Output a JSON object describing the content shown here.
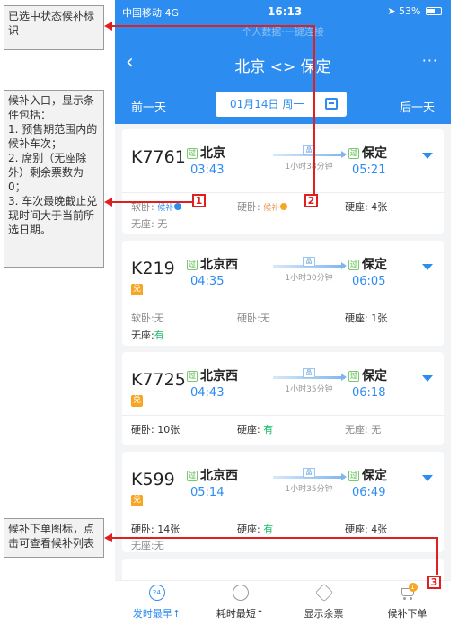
{
  "statusbar": {
    "carrier": "中国移动 4G",
    "time": "16:13",
    "battery": "53%"
  },
  "faded_subtitle": "个人数据·一键连接",
  "nav": {
    "title": "北京 <> 保定",
    "back": "‹",
    "more": "···"
  },
  "datebar": {
    "prev": "前一天",
    "date": "01月14日 周一",
    "next": "后一天"
  },
  "trains": [
    {
      "no": "K7761",
      "dui": false,
      "from": "北京",
      "depart": "03:43",
      "duration": "1小时38分钟",
      "to": "保定",
      "arrive": "05:21",
      "seats": [
        {
          "label": "软卧:",
          "value": "候补",
          "style": "blue",
          "dot": "#2d8cf0"
        },
        {
          "label": "硬卧:",
          "value": "候补",
          "style": "orange",
          "dot": "#f6a623"
        },
        {
          "label": "硬座:",
          "value": "4张",
          "style": "dark"
        },
        {
          "label": "无座:",
          "value": "无",
          "style": "plain"
        }
      ]
    },
    {
      "no": "K219",
      "dui": true,
      "from": "北京西",
      "depart": "04:35",
      "duration": "1小时30分钟",
      "to": "保定",
      "arrive": "06:05",
      "seats": [
        {
          "label": "软卧:",
          "value": "无",
          "style": "plain"
        },
        {
          "label": "硬卧:",
          "value": "无",
          "style": "plain"
        },
        {
          "label": "硬座:",
          "value": "1张",
          "style": "dark"
        },
        {
          "label": "无座:",
          "value": "有",
          "style": "green"
        }
      ]
    },
    {
      "no": "K7725",
      "dui": true,
      "from": "北京西",
      "depart": "04:43",
      "duration": "1小时35分钟",
      "to": "保定",
      "arrive": "06:18",
      "seats": [
        {
          "label": "硬卧:",
          "value": "10张",
          "style": "dark"
        },
        {
          "label": "硬座:",
          "value": "有",
          "style": "green"
        },
        {
          "label": "无座:",
          "value": "无",
          "style": "plain"
        }
      ]
    },
    {
      "no": "K599",
      "dui": true,
      "from": "北京西",
      "depart": "05:14",
      "duration": "1小时35分钟",
      "to": "保定",
      "arrive": "06:49",
      "seats": [
        {
          "label": "硬卧:",
          "value": "14张",
          "style": "dark"
        },
        {
          "label": "硬座:",
          "value": "有",
          "style": "green"
        },
        {
          "label": "硬座:",
          "value": "4张",
          "style": "dark"
        },
        {
          "label": "无座:",
          "value": "无",
          "style": "plain"
        }
      ]
    }
  ],
  "tags": {
    "through": "过",
    "dui": "兑",
    "mid_badge": "晶"
  },
  "tabs": [
    {
      "label": "发时最早↑",
      "icon": "clock-24-icon",
      "icon_text": "24",
      "active": true
    },
    {
      "label": "耗时最短↑",
      "icon": "timer-icon",
      "icon_text": "",
      "active": false
    },
    {
      "label": "显示余票",
      "icon": "ticket-icon",
      "icon_text": "",
      "active": false
    },
    {
      "label": "候补下单",
      "icon": "cart-icon",
      "icon_text": "",
      "badge": "1",
      "active": false
    }
  ],
  "notes": {
    "n1": "已选中状态候补标识",
    "n2": "候补入口，显示条件包括：\n1. 预售期范围内的候补车次；\n2. 席别（无座除外）剩余票数为0；\n3. 车次最晚截止兑现时间大于当前所选日期。",
    "n3": "候补下单图标，点击可查看候补列表"
  },
  "markers": [
    "1",
    "2",
    "3"
  ],
  "colors": {
    "primary": "#2d8cf0",
    "green": "#19be6b",
    "orange": "#f6a623",
    "annotation": "#e02020"
  }
}
